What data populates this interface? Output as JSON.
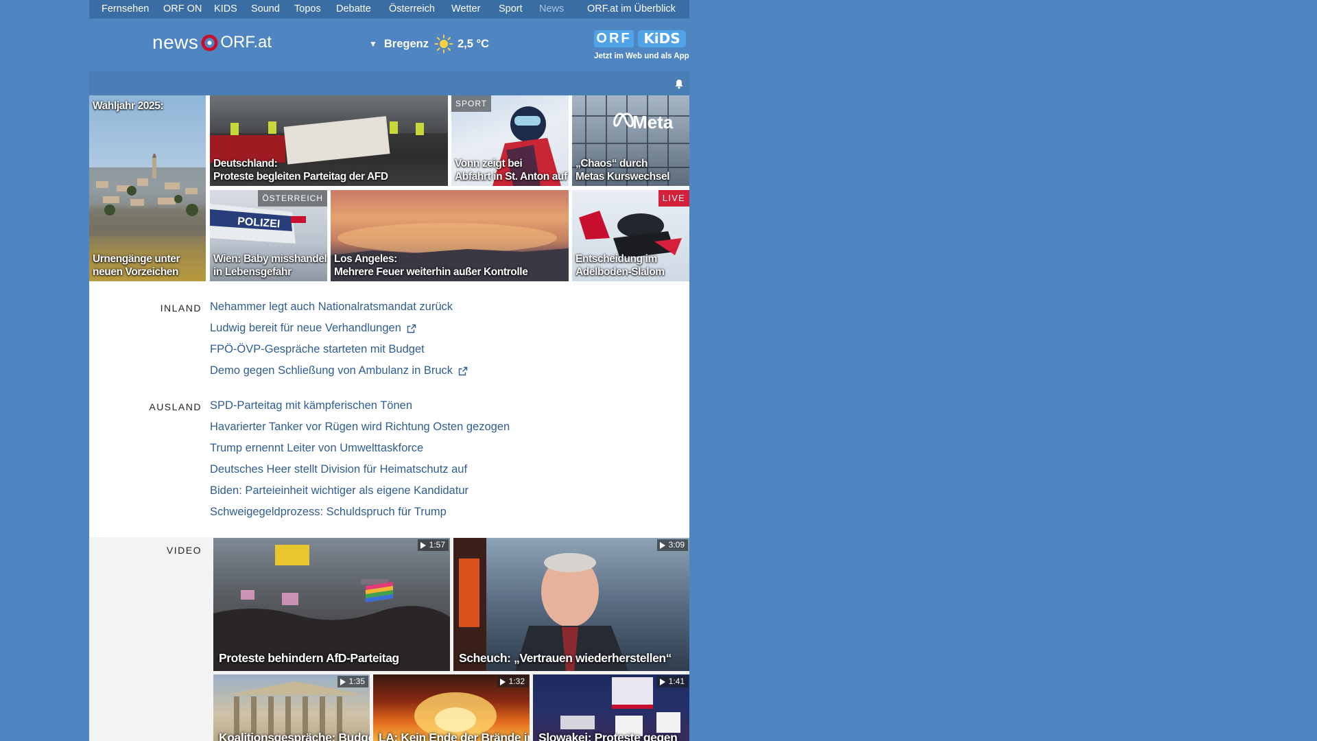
{
  "topnav": {
    "items": [
      "Fernsehen",
      "ORF ON",
      "KIDS",
      "Sound",
      "Topos",
      "Debatte",
      "Österreich",
      "Wetter",
      "Sport",
      "News",
      "ORF.at im Überblick"
    ],
    "active": "News"
  },
  "header": {
    "logo_news": "news",
    "logo_orf": "ORF.at",
    "weather": {
      "city": "Bregenz",
      "temp": "2,5 °C",
      "icon": "sun-icon"
    },
    "kids": {
      "orf": "ORF",
      "kids": "KiDS",
      "sub": "Jetzt im Web und als App"
    }
  },
  "tiles": [
    {
      "name": "wahljahr",
      "lines": [
        "Urnengänge unter",
        "neuen Vorzeichen"
      ],
      "top_label": "Wahljahr 2025:"
    },
    {
      "name": "afd",
      "lines": [
        "Deutschland:",
        "Proteste begleiten Parteitag der AFD"
      ]
    },
    {
      "name": "vonn",
      "lines": [
        "Vonn zeigt bei",
        "Abfahrt in St. Anton auf"
      ],
      "tag": "SPORT"
    },
    {
      "name": "meta",
      "lines": [
        "„Chaos“ durch",
        "Metas Kurswechsel"
      ]
    },
    {
      "name": "wien",
      "lines": [
        "Wien: Baby misshandelt,",
        "in Lebensgefahr"
      ],
      "tag": "ÖSTERREICH"
    },
    {
      "name": "la",
      "lines": [
        "Los Angeles:",
        "Mehrere Feuer weiterhin außer Kontrolle"
      ]
    },
    {
      "name": "adelboden",
      "lines": [
        "Entscheidung im",
        "Adelboden-Slalom"
      ],
      "tag": "LIVE"
    }
  ],
  "inland": {
    "label": "INLAND",
    "items": [
      {
        "text": "Nehammer legt auch Nationalratsmandat zurück",
        "external": false
      },
      {
        "text": "Ludwig bereit für neue Verhandlungen",
        "external": true
      },
      {
        "text": "FPÖ-ÖVP-Gespräche starteten mit Budget",
        "external": false
      },
      {
        "text": "Demo gegen Schließung von Ambulanz in Bruck",
        "external": true
      }
    ]
  },
  "ausland": {
    "label": "AUSLAND",
    "items": [
      {
        "text": "SPD-Parteitag mit kämpferischen Tönen",
        "external": false
      },
      {
        "text": "Havarierter Tanker vor Rügen wird Richtung Osten gezogen",
        "external": false
      },
      {
        "text": "Trump ernennt Leiter von Umwelttaskforce",
        "external": false
      },
      {
        "text": "Deutsches Heer stellt Division für Heimatschutz auf",
        "external": false
      },
      {
        "text": "Biden: Parteieinheit wichtiger als eigene Kandidatur",
        "external": false
      },
      {
        "text": "Schweigegeldprozess: Schuldspruch für Trump",
        "external": false
      }
    ]
  },
  "video": {
    "label": "VIDEO",
    "items": [
      {
        "title": "Proteste behindern AfD-Parteitag",
        "duration": "1:57"
      },
      {
        "title": "Scheuch: „Vertrauen wiederherstellen“",
        "duration": "3:09"
      },
      {
        "title": "Koalitionsgespräche: Budget",
        "duration": "1:35"
      },
      {
        "title": "LA: Kein Ende der Brände in",
        "duration": "1:32"
      },
      {
        "title": "Slowakei: Proteste gegen",
        "duration": "1:41"
      }
    ]
  },
  "colors": {
    "page_bg": "#4f85c0",
    "topnav_bg": "#3a6da3",
    "link": "#2f5d91",
    "live": "#d4203a",
    "orf_red": "#c8102e"
  }
}
